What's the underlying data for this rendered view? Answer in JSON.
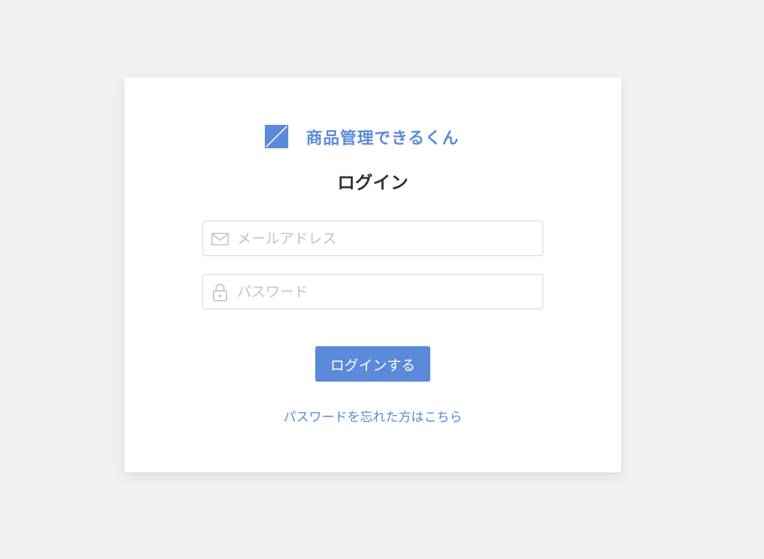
{
  "brand": {
    "name": "商品管理できるくん",
    "logo_icon": "slash-square-logo",
    "color": "#5a8ad9"
  },
  "login_form": {
    "title": "ログイン",
    "email": {
      "icon": "envelope-icon",
      "placeholder": "メールアドレス",
      "value": ""
    },
    "password": {
      "icon": "lock-icon",
      "placeholder": "パスワード",
      "value": ""
    },
    "submit_label": "ログインする",
    "forgot_password_label": "パスワードを忘れた方はこちら"
  },
  "colors": {
    "accent": "#5a8ad9",
    "background": "#f0f1f1",
    "card": "#ffffff",
    "title_text": "#2f3136",
    "placeholder": "#c3c3c3",
    "border": "#d4d4d4"
  }
}
